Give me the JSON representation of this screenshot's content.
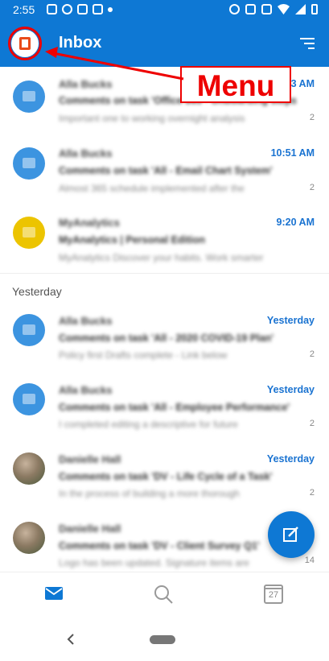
{
  "status_bar": {
    "time": "2:55"
  },
  "app_bar": {
    "title": "Inbox"
  },
  "annotation": {
    "label": "Menu"
  },
  "section": {
    "yesterday_label": "Yesterday"
  },
  "messages": [
    {
      "sender": "Alla Bucks",
      "subject": "Comments on task 'Office 365 - Onboarding steps'",
      "preview": "Important one to working overnight analysis",
      "time": "1:23 AM",
      "count": "2",
      "avatar": "blue"
    },
    {
      "sender": "Alla Bucks",
      "subject": "Comments on task 'All - Email Chart System'",
      "preview": "Almost 365 schedule implemented after the",
      "time": "10:51 AM",
      "count": "2",
      "avatar": "blue"
    },
    {
      "sender": "MyAnalytics",
      "subject": "MyAnalytics | Personal Edition",
      "preview": "MyAnalytics Discover your habits. Work smarter",
      "time": "9:20 AM",
      "count": "",
      "avatar": "yellow"
    },
    {
      "sender": "Alla Bucks",
      "subject": "Comments on task 'All - 2020 COVID-19 Plan'",
      "preview": "Policy first Drafts complete - Link below",
      "time": "Yesterday",
      "count": "2",
      "avatar": "blue"
    },
    {
      "sender": "Alla Bucks",
      "subject": "Comments on task 'All - Employee Performance'",
      "preview": "I completed editing a descriptive for future",
      "time": "Yesterday",
      "count": "2",
      "avatar": "blue"
    },
    {
      "sender": "Danielle Hall",
      "subject": "Comments on task 'DV - Life Cycle of a Task'",
      "preview": "In the process of building a more thorough",
      "time": "Yesterday",
      "count": "2",
      "avatar": "photo"
    },
    {
      "sender": "Danielle Hall",
      "subject": "Comments on task 'DV - Client Survey Q1'",
      "preview": "Logo has been updated. Signature items are",
      "time": "Yesterday",
      "count": "14",
      "avatar": "photo"
    }
  ],
  "bottom_nav": {
    "calendar_day": "27"
  },
  "icons": {
    "office": "office-logo-icon",
    "filter": "filter-icon",
    "compose": "compose-icon",
    "mail": "mail-icon",
    "search": "search-icon",
    "calendar": "calendar-icon",
    "back": "back-icon",
    "home": "home-pill-icon"
  },
  "colors": {
    "brand": "#0e78d4",
    "time_accent": "#1a73d1",
    "annotation": "#e00000"
  }
}
